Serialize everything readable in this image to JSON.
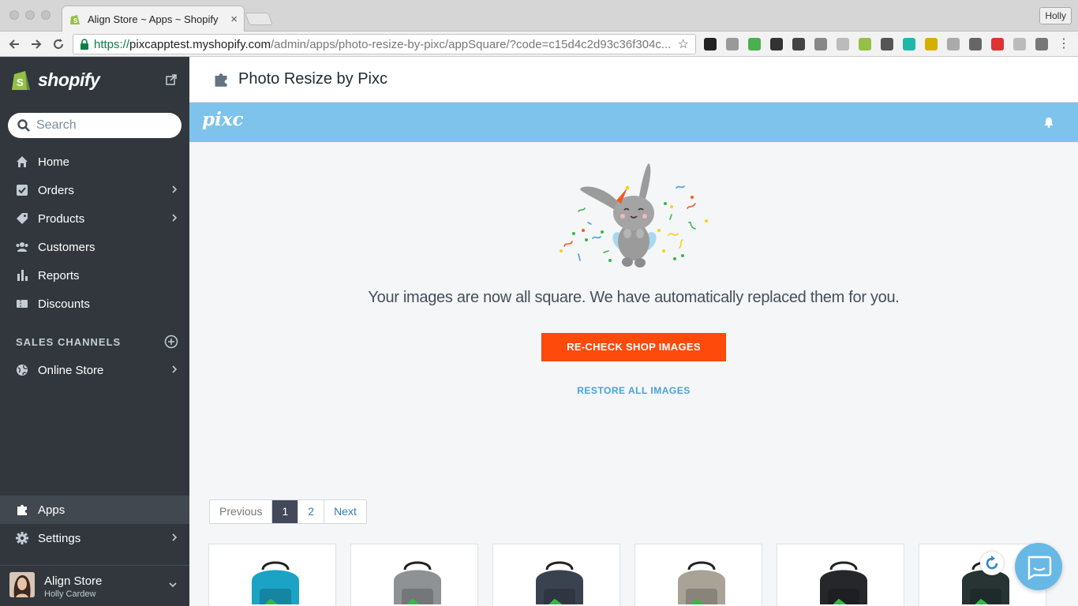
{
  "browser": {
    "tab_title": "Align Store ~ Apps ~ Shopify",
    "tab_close": "×",
    "profile_name": "Holly",
    "url": {
      "secure_prefix": "https://",
      "host": "pixcapptest.myshopify.com",
      "path": "/admin/apps/photo-resize-by-pixc/appSquare/?code=c15d4c2d93c36f304c..."
    },
    "nav_icons": [
      "back-icon",
      "forward-icon",
      "reload-icon"
    ],
    "extension_icons": [
      "buffer-icon",
      "ghost-icon",
      "evernote-icon",
      "bw-icon",
      "medium-icon",
      "squirrel-icon",
      "screen-icon",
      "shopify-icon",
      "r-icon",
      "m-icon",
      "bolt-icon",
      "doc-icon",
      "chat-icon",
      "tag-icon",
      "b-icon",
      "tools-icon",
      "menu-icon"
    ]
  },
  "sidebar": {
    "brand": "shopify",
    "search_placeholder": "Search",
    "nav_items": [
      {
        "label": "Home",
        "icon": "home-icon",
        "has_chevron": false
      },
      {
        "label": "Orders",
        "icon": "orders-icon",
        "has_chevron": true
      },
      {
        "label": "Products",
        "icon": "tag-icon",
        "has_chevron": true
      },
      {
        "label": "Customers",
        "icon": "customers-icon",
        "has_chevron": false
      },
      {
        "label": "Reports",
        "icon": "reports-icon",
        "has_chevron": false
      },
      {
        "label": "Discounts",
        "icon": "discounts-icon",
        "has_chevron": false
      }
    ],
    "sales_channels_heading": "SALES CHANNELS",
    "channels": [
      {
        "label": "Online Store",
        "icon": "globe-icon",
        "has_chevron": true
      }
    ],
    "bottom_items": [
      {
        "label": "Apps",
        "icon": "puzzle-icon",
        "active": true
      },
      {
        "label": "Settings",
        "icon": "gear-icon",
        "has_chevron": true
      }
    ],
    "store": {
      "name": "Align Store",
      "user": "Holly Cardew"
    }
  },
  "main": {
    "page_title": "Photo Resize by Pixc",
    "app_logo": "pixc",
    "headline": "Your images are now all square. We have automatically replaced them for you.",
    "recheck_button": "RE-CHECK SHOP IMAGES",
    "restore_link": "RESTORE ALL IMAGES",
    "pagination": {
      "previous": "Previous",
      "pages": [
        "1",
        "2"
      ],
      "current": "1",
      "next": "Next"
    },
    "images": [
      {
        "alt": "teal backpack",
        "color": "#1aa3c5"
      },
      {
        "alt": "grey backpack",
        "color": "#8e9294"
      },
      {
        "alt": "navy backpack",
        "color": "#3a4250"
      },
      {
        "alt": "beige backpack",
        "color": "#a8a297"
      },
      {
        "alt": "black backpack",
        "color": "#25272a"
      },
      {
        "alt": "dark green backpack",
        "color": "#283434"
      }
    ]
  },
  "colors": {
    "sidebar_bg": "#31373d",
    "pixc_header": "#7dc3ec",
    "primary_button": "#fe4a0a",
    "link": "#4ba1d6",
    "chat": "#68b8e6"
  }
}
